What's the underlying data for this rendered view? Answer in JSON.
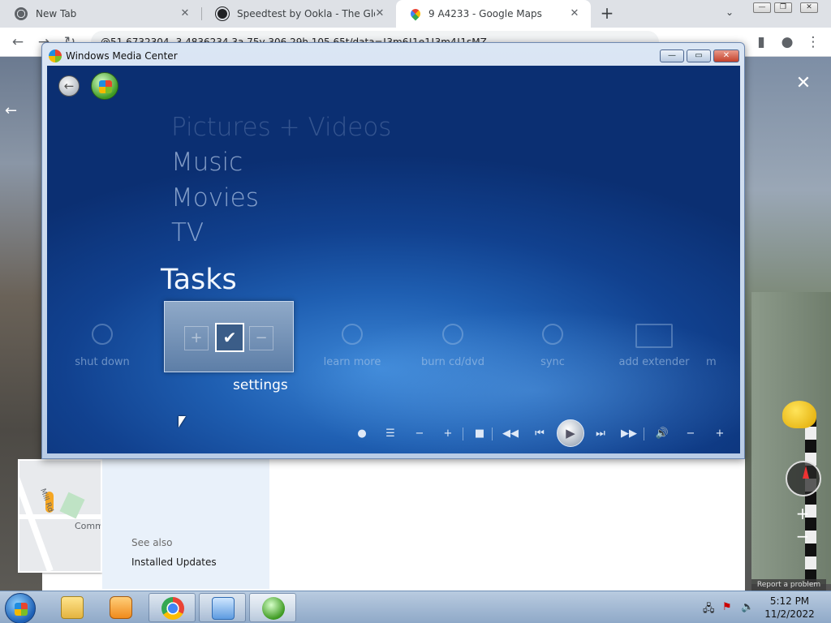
{
  "browser": {
    "tabs": [
      {
        "title": "New Tab",
        "active": false
      },
      {
        "title": "Speedtest by Ookla - The Global",
        "active": false
      },
      {
        "title": "9 A4233 - Google Maps",
        "active": true
      }
    ],
    "new_tab_glyph": "+",
    "address": "@51.6732304,-3.4836234,3a,75y,306.29h,105.65t/data=!3m6!1e1!3m4!1sMZ"
  },
  "maps": {
    "see_also": "See also",
    "installed_updates": "Installed Updates",
    "minimap_road_label": "Mill Rd",
    "minimap_place_label": "Comm",
    "report_problem": "Report a problem"
  },
  "wmc": {
    "title": "Windows Media Center",
    "menu": {
      "pictures": "Pictures + Videos",
      "music": "Music",
      "movies": "Movies",
      "tv": "TV",
      "tasks": "Tasks"
    },
    "tasks": {
      "shut_down": "shut down",
      "settings": "settings",
      "learn_more": "learn more",
      "burn": "burn cd/dvd",
      "sync": "sync",
      "add_extender": "add extender",
      "media_only": "m"
    },
    "focus_minus": "−",
    "focus_plus": "+"
  },
  "taskbar": {
    "time": "5:12 PM",
    "date": "11/2/2022"
  }
}
